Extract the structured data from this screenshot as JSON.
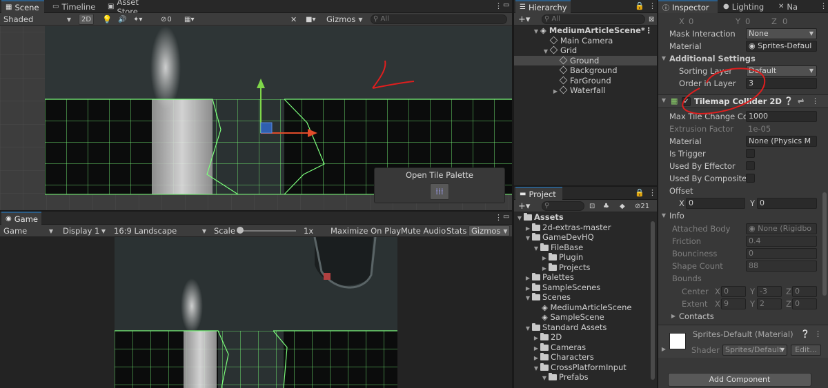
{
  "scene": {
    "tabs": [
      "Scene",
      "Timeline",
      "Asset Store"
    ],
    "shading": "Shaded",
    "mode_2d": "2D",
    "hidden_count": "0",
    "gizmos": "Gizmos",
    "search_placeholder": "All",
    "overlay": {
      "title": "Open Tile Palette"
    }
  },
  "game": {
    "tab": "Game",
    "display_type": "Game",
    "display": "Display 1",
    "aspect": "16:9 Landscape",
    "scale_label": "Scale",
    "scale_value": "1x",
    "maximize": "Maximize On Play",
    "mute": "Mute Audio",
    "stats": "Stats",
    "gizmos": "Gizmos"
  },
  "hierarchy": {
    "tab": "Hierarchy",
    "search_placeholder": "All",
    "scene": "MediumArticleScene*",
    "items": [
      "Main Camera",
      "Grid",
      "Ground",
      "Background",
      "FarGround",
      "Waterfall"
    ]
  },
  "project": {
    "tab": "Project",
    "badge": "21",
    "items": [
      "Assets",
      "2d-extras-master",
      "GameDevHQ",
      "FileBase",
      "Plugin",
      "Projects",
      "Palettes",
      "SampleScenes",
      "Scenes",
      "MediumArticleScene",
      "SampleScene",
      "Standard Assets",
      "2D",
      "Cameras",
      "Characters",
      "CrossPlatformInput",
      "Prefabs"
    ]
  },
  "inspector": {
    "tabs": [
      "Inspector",
      "Lighting",
      "Na"
    ],
    "top_xyz": [
      "X",
      "0",
      "Y",
      "0",
      "Z",
      "0"
    ],
    "mask_interaction": {
      "label": "Mask Interaction",
      "value": "None"
    },
    "material": {
      "label": "Material",
      "value": "Sprites-Defaul"
    },
    "additional_settings": "Additional Settings",
    "sorting_layer": {
      "label": "Sorting Layer",
      "value": "Default"
    },
    "order_in_layer": {
      "label": "Order in Layer",
      "value": "3"
    },
    "collider": {
      "title": "Tilemap Collider 2D",
      "max_tile": {
        "label": "Max Tile Change Cou",
        "value": "1000"
      },
      "extrusion": {
        "label": "Extrusion Factor",
        "value": "1e-05"
      },
      "material": {
        "label": "Material",
        "value": "None (Physics M"
      },
      "is_trigger": "Is Trigger",
      "used_by_effector": "Used By Effector",
      "used_by_composite": "Used By Composite",
      "offset": "Offset",
      "offset_x": "0",
      "offset_y": "0",
      "x": "X",
      "y": "Y",
      "z": "Z"
    },
    "info": {
      "title": "Info",
      "attached_body": {
        "label": "Attached Body",
        "value": "None (Rigidbo"
      },
      "friction": {
        "label": "Friction",
        "value": "0.4"
      },
      "bounciness": {
        "label": "Bounciness",
        "value": "0"
      },
      "shape_count": {
        "label": "Shape Count",
        "value": "88"
      },
      "bounds": "Bounds",
      "center": {
        "label": "Center",
        "x": "0",
        "y": "-3",
        "z": "0"
      },
      "extent": {
        "label": "Extent",
        "x": "9",
        "y": "2",
        "z": "0"
      },
      "contacts": "Contacts"
    },
    "material_asset": {
      "name": "Sprites-Default (Material)",
      "shader_label": "Shader",
      "shader_value": "Sprites/Default",
      "edit": "Edit..."
    },
    "add_component": "Add Component"
  },
  "colors": {
    "grid_green": "#7dff7d",
    "annotation_red": "#e01e1e",
    "accent_blue": "#2c5d87"
  }
}
